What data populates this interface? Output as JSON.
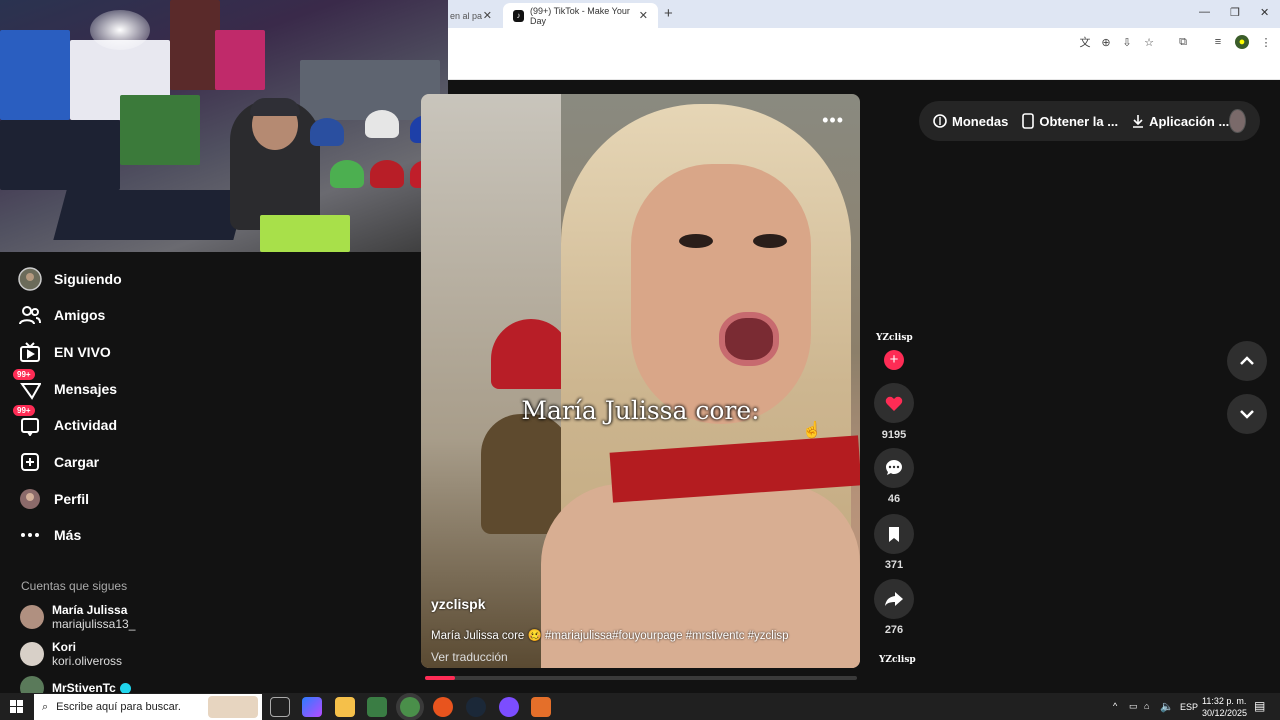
{
  "browser": {
    "tabs": [
      {
        "label": "en al pa",
        "active": false
      },
      {
        "label": "(99+) TikTok - Make Your Day",
        "active": true
      }
    ],
    "new_tab_icon": "plus-icon",
    "window_controls": [
      "minimize-icon",
      "restore-icon",
      "close-icon"
    ]
  },
  "topnav": {
    "coins": "Monedas",
    "get_app": "Obtener la ...",
    "download_app": "Aplicación ..."
  },
  "sidebar": {
    "items": [
      {
        "label": "Siguiendo",
        "icon": "following-avatar-icon",
        "badge": ""
      },
      {
        "label": "Amigos",
        "icon": "friends-icon",
        "badge": ""
      },
      {
        "label": "EN VIVO",
        "icon": "live-tv-icon",
        "badge": ""
      },
      {
        "label": "Mensajes",
        "icon": "messages-icon",
        "badge": "99+"
      },
      {
        "label": "Actividad",
        "icon": "activity-icon",
        "badge": "99+"
      },
      {
        "label": "Cargar",
        "icon": "upload-icon",
        "badge": ""
      },
      {
        "label": "Perfil",
        "icon": "profile-avatar-icon",
        "badge": ""
      },
      {
        "label": "Más",
        "icon": "more-icon",
        "badge": ""
      }
    ],
    "following_title": "Cuentas que sigues",
    "accounts": [
      {
        "name": "María Julissa",
        "handle": "mariajulissa13_",
        "verified": false
      },
      {
        "name": "Kori",
        "handle": "kori.oliveross",
        "verified": false
      },
      {
        "name": "MrStivenTc",
        "handle": "",
        "verified": true
      }
    ]
  },
  "video": {
    "caption_overlay": "María Julissa core:",
    "username": "yzclispk",
    "description": "María Julissa core 🥴 #mariajulissa#fouyourpage #mrstiventc #yzclisp",
    "translate": "Ver traducción",
    "progress": 0.07,
    "author_mark": "YZclisp"
  },
  "actions": {
    "likes": "9195",
    "comments": "46",
    "saves": "371",
    "shares": "276"
  },
  "taskbar": {
    "search_placeholder": "Escribe aquí para buscar.",
    "lang": "ESP",
    "time": "11:32 p. m.",
    "date": "30/12/2025"
  },
  "colors": {
    "accent": "#fe2c55",
    "background": "#121212",
    "button_bg": "#2f2f2f"
  }
}
